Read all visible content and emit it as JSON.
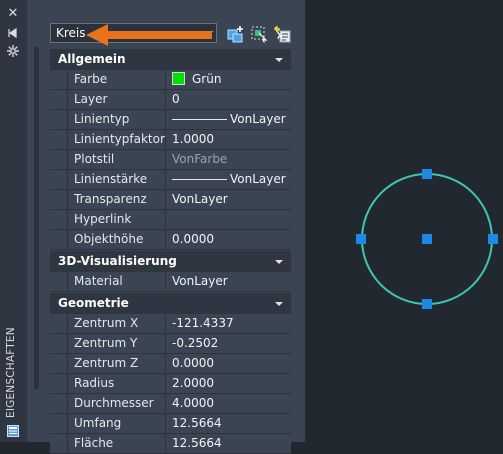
{
  "palette": {
    "title": "EIGENSCHAFTEN",
    "selection_type": "Kreis",
    "colors": {
      "accent_arrow": "#e8731a",
      "grip": "#1e88e5",
      "circle": "#3cc7b0",
      "swatch": "#00e000"
    }
  },
  "categories": [
    {
      "label": "Allgemein",
      "rows": [
        {
          "name": "Farbe",
          "value": "Grün",
          "kind": "color"
        },
        {
          "name": "Layer",
          "value": "0"
        },
        {
          "name": "Linientyp",
          "value": "VonLayer",
          "kind": "line"
        },
        {
          "name": "Linientypfaktor",
          "value": "1.0000"
        },
        {
          "name": "Plotstil",
          "value": "VonFarbe",
          "kind": "dim"
        },
        {
          "name": "Linienstärke",
          "value": "VonLayer",
          "kind": "line"
        },
        {
          "name": "Transparenz",
          "value": "VonLayer"
        },
        {
          "name": "Hyperlink",
          "value": ""
        },
        {
          "name": "Objekthöhe",
          "value": "0.0000"
        }
      ]
    },
    {
      "label": "3D-Visualisierung",
      "rows": [
        {
          "name": "Material",
          "value": "VonLayer"
        }
      ]
    },
    {
      "label": "Geometrie",
      "rows": [
        {
          "name": "Zentrum X",
          "value": "-121.4337"
        },
        {
          "name": "Zentrum Y",
          "value": "-0.2502"
        },
        {
          "name": "Zentrum Z",
          "value": "0.0000"
        },
        {
          "name": "Radius",
          "value": "2.0000"
        },
        {
          "name": "Durchmesser",
          "value": "4.0000"
        },
        {
          "name": "Umfang",
          "value": "12.5664"
        },
        {
          "name": "Fläche",
          "value": "12.5664"
        }
      ]
    }
  ],
  "icons": {
    "close": "close-icon",
    "autohide": "autohide-icon",
    "properties": "properties-settings-icon",
    "toggle_pickadd": "toggle-pickadd-icon",
    "select_objects": "select-objects-icon",
    "quick_select": "quick-select-icon"
  }
}
